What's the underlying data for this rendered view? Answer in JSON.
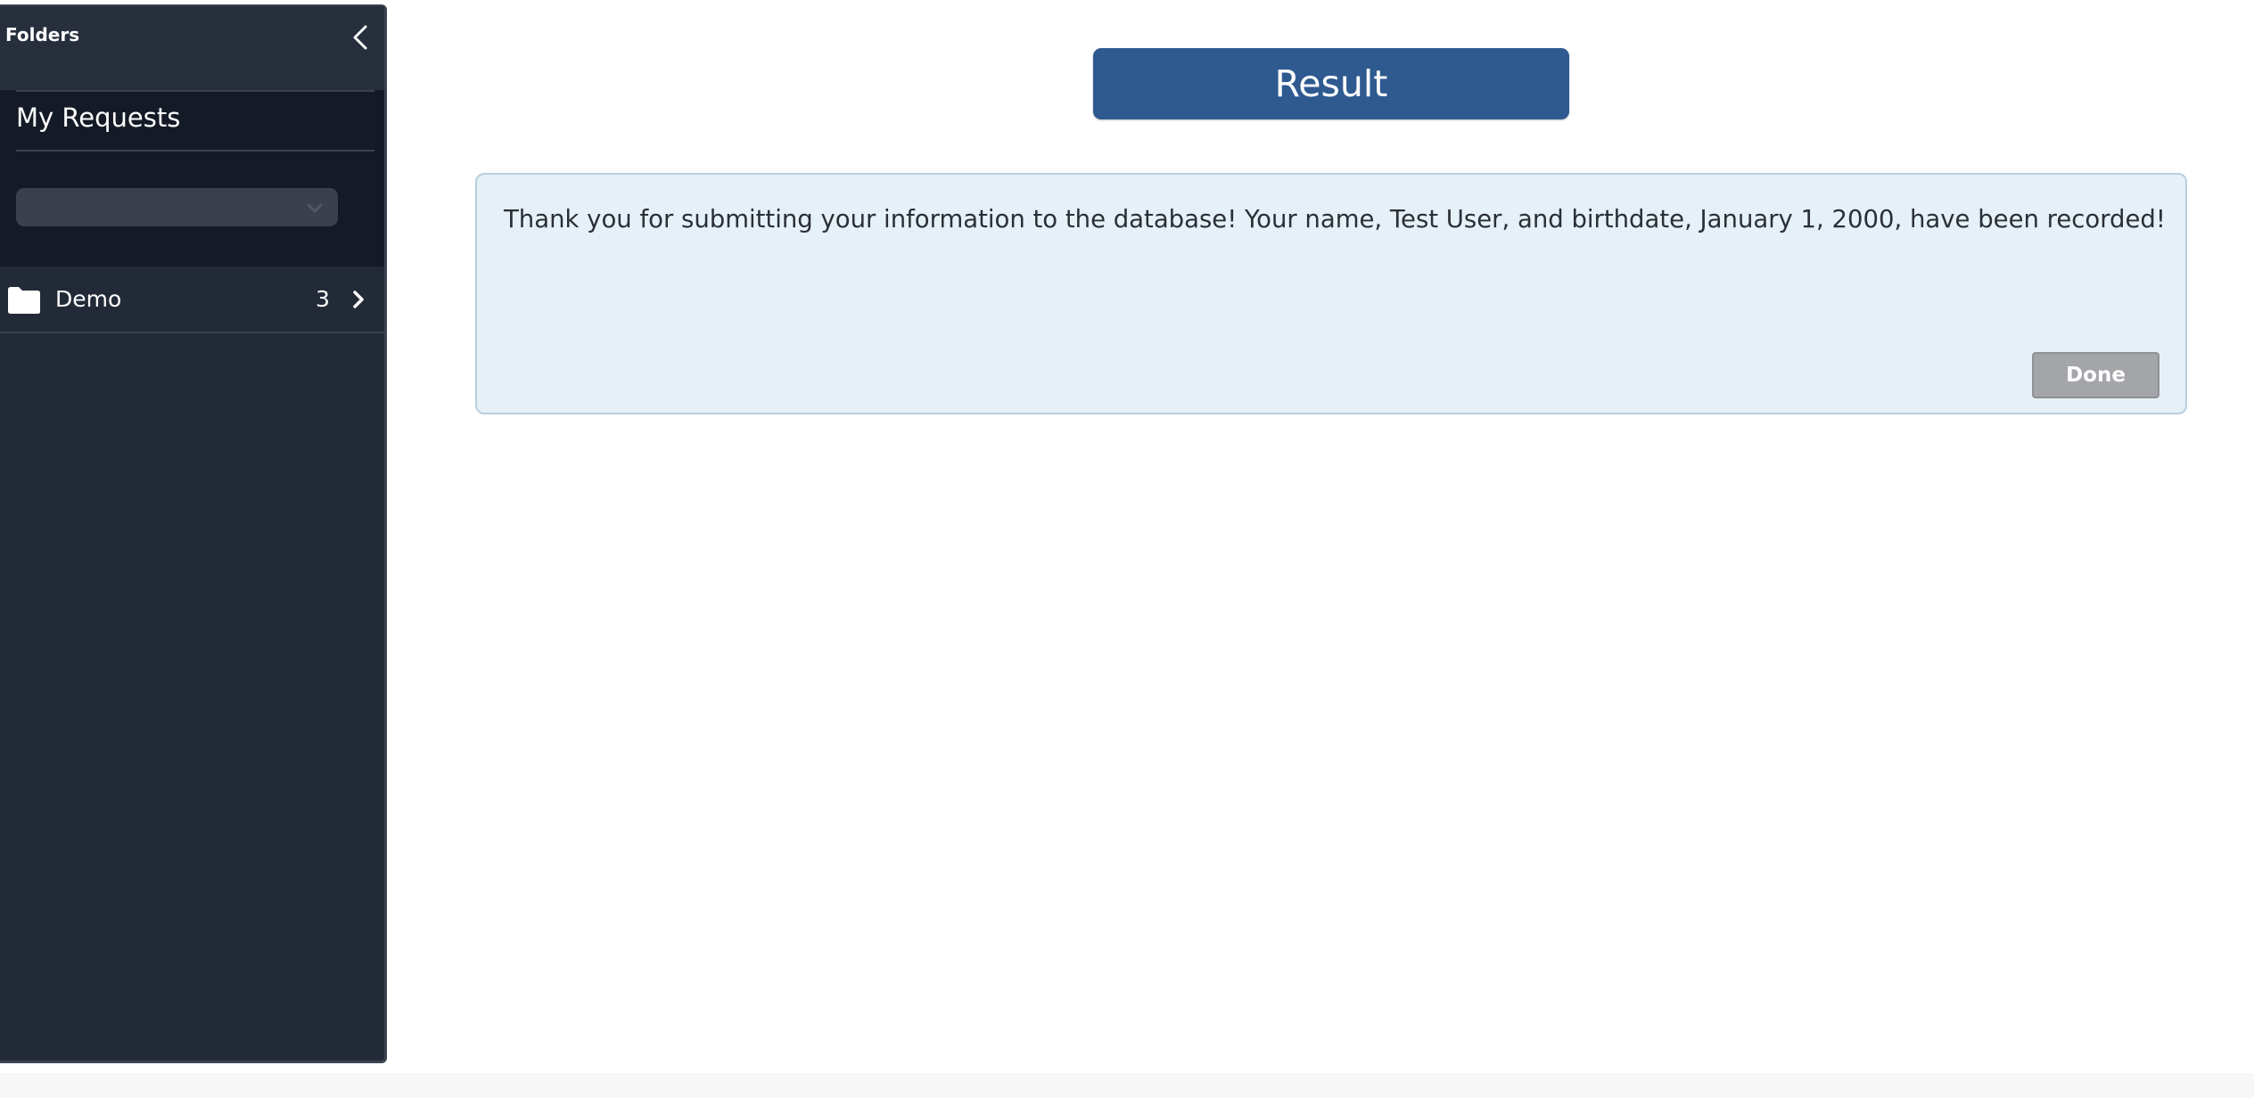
{
  "sidebar": {
    "header_title": "Folders",
    "collapse_icon": "chevron-left-icon",
    "section_title": "My Requests",
    "dropdown": {
      "selected_value": "",
      "icon": "chevron-down-icon"
    },
    "folders": [
      {
        "name": "Demo",
        "count": "3",
        "icon": "folder-icon",
        "chevron_icon": "chevron-right-icon"
      }
    ]
  },
  "main": {
    "title": "Result",
    "message": "Thank you for submitting your information to the database! Your name, Test User, and birthdate, January 1, 2000, have been recorded!",
    "done_label": "Done"
  },
  "colors": {
    "sidebar_bg": "#232a37",
    "panel_bg": "#141a26",
    "title_bar": "#2f5a90",
    "card_bg": "#e6f0f7",
    "done_button": "#a3a5a8"
  }
}
